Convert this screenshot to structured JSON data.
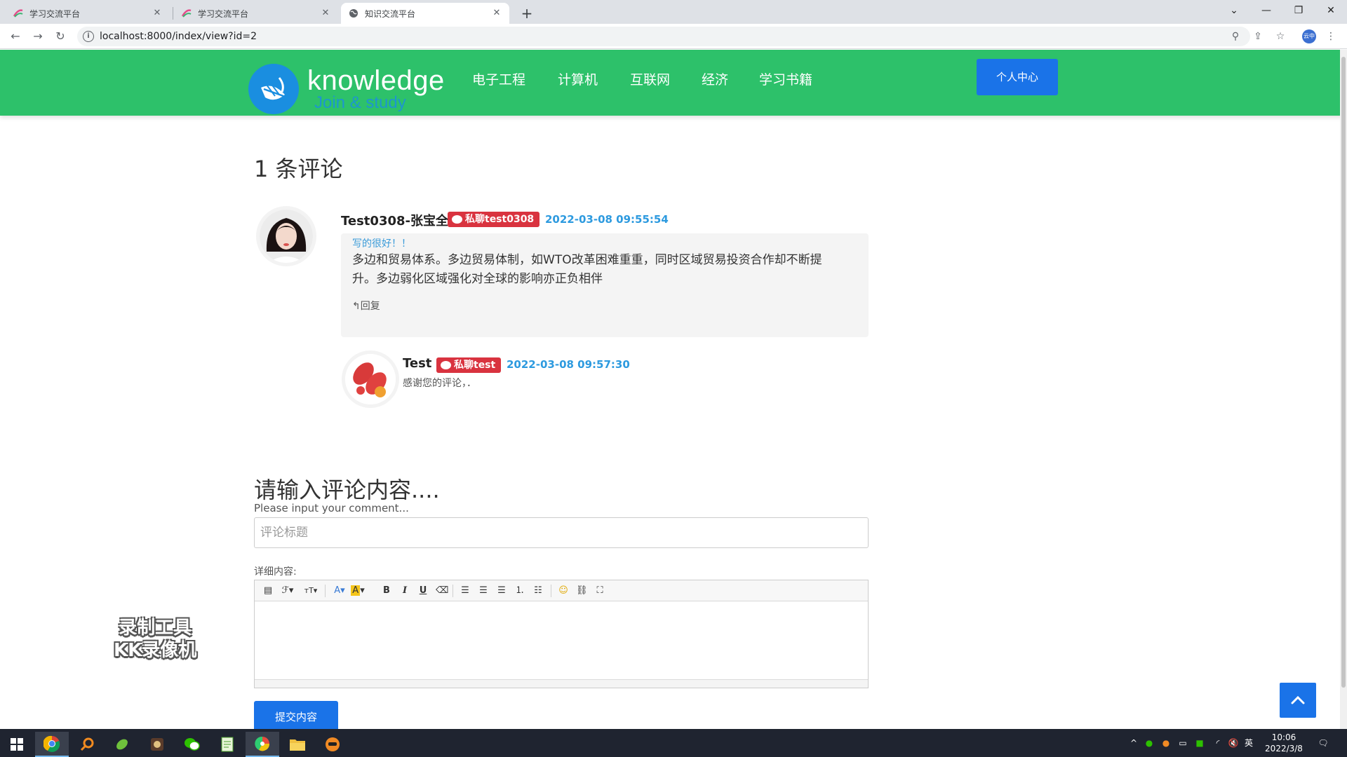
{
  "browser": {
    "tabs": [
      {
        "title": "学习交流平台",
        "active": false
      },
      {
        "title": "学习交流平台",
        "active": false
      },
      {
        "title": "知识交流平台",
        "active": true
      }
    ],
    "url": "localhost:8000/index/view?id=2",
    "profile_label": "云中"
  },
  "site": {
    "logo_text": "knowledge",
    "logo_subtext": "Join & study",
    "nav": [
      "电子工程",
      "计算机",
      "互联网",
      "经济",
      "学习书籍"
    ],
    "user_center_label": "个人中心",
    "colors": {
      "header": "#2dc16a",
      "primary_button": "#1a73e8",
      "badge": "#d9333f",
      "timestamp": "#2d9adf"
    }
  },
  "comments": {
    "heading": "1 条评论",
    "items": [
      {
        "author": "Test0308-张宝全",
        "pm_label": "私聊test0308",
        "time": "2022-03-08 09:55:54",
        "title": "写的很好！！",
        "body": "多边和贸易体系。多边贸易体制，如WTO改革困难重重，同时区域贸易投资合作却不断提升。多边弱化区域强化对全球的影响亦正负相伴",
        "reply_label": "回复",
        "replies": [
          {
            "author": "Test",
            "pm_label": "私聊test",
            "time": "2022-03-08 09:57:30",
            "body": "感谢您的评论，．"
          }
        ]
      }
    ]
  },
  "form": {
    "heading": "请输入评论内容....",
    "subheading": "Please input your comment...",
    "title_placeholder": "评论标题",
    "detail_label": "详细内容:",
    "submit_label": "提交内容"
  },
  "watermark": {
    "line1": "录制工具",
    "line2": "KK录像机"
  },
  "taskbar": {
    "time": "10:06",
    "date": "2022/3/8",
    "ime": "英"
  }
}
